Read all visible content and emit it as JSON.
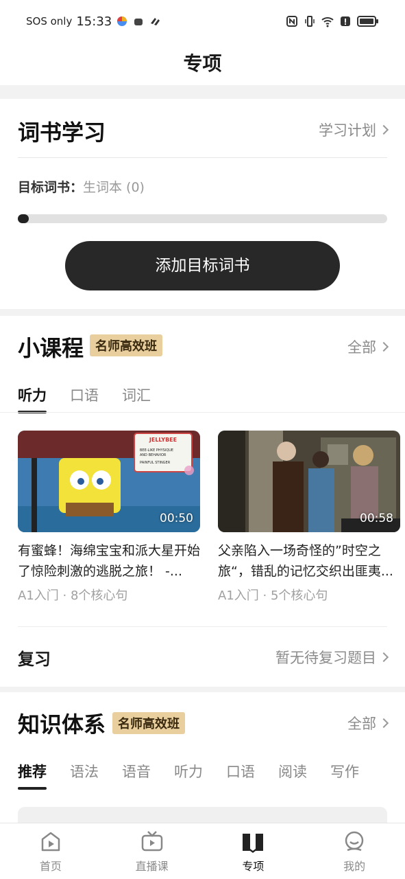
{
  "status_bar": {
    "carrier": "SOS only",
    "time": "15:33"
  },
  "header": {
    "title": "专项"
  },
  "word_book": {
    "title": "词书学习",
    "plan_link": "学习计划",
    "target_label": "目标词书：",
    "target_value": "生词本 (0)",
    "progress": 0,
    "add_button": "添加目标词书"
  },
  "mini_course": {
    "title": "小课程",
    "badge": "名师高效班",
    "all_link": "全部",
    "tabs": [
      "听力",
      "口语",
      "词汇"
    ],
    "active_tab": 0,
    "videos": [
      {
        "duration": "00:50",
        "title": "有蜜蜂！海绵宝宝和派大星开始了惊险刺激的逃脱之旅！ -...",
        "level": "A1入门",
        "count": "8个核心句",
        "sign_text": [
          "JELLYBEE",
          "BEE-LIKE PHYSIQUE",
          "AND BEHAVIOR",
          "PAINFUL STINGER"
        ]
      },
      {
        "duration": "00:58",
        "title": "父亲陷入一场奇怪的”时空之旅“，错乱的记忆交织出匪夷...",
        "level": "A1入门",
        "count": "5个核心句"
      }
    ],
    "review": {
      "title": "复习",
      "status": "暂无待复习题目"
    }
  },
  "knowledge": {
    "title": "知识体系",
    "badge": "名师高效班",
    "all_link": "全部",
    "tabs": [
      "推荐",
      "语法",
      "语音",
      "听力",
      "口语",
      "阅读",
      "写作"
    ],
    "active_tab": 0
  },
  "bottom_nav": {
    "items": [
      "首页",
      "直播课",
      "专项",
      "我的"
    ],
    "active": 2
  },
  "colors": {
    "accent_dark": "#282828",
    "badge_bg": "#e9cf9e",
    "muted_text": "#8a8a8a"
  }
}
